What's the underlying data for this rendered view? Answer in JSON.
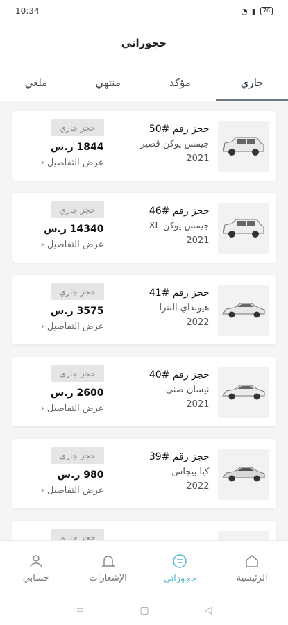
{
  "status_bar": {
    "time": "10:34",
    "battery": "76"
  },
  "header": {
    "title": "حجوزاتي"
  },
  "tabs": [
    {
      "label": "جاري"
    },
    {
      "label": "مؤكد"
    },
    {
      "label": "منتهي"
    },
    {
      "label": "ملغي"
    }
  ],
  "bookings": [
    {
      "booking_no": "حجز رقم #50",
      "car": "جيمس يوكن قصير",
      "year": "2021",
      "status": "حجز جاري",
      "price": "1844 ر.س",
      "details": "عرض التفاصيل"
    },
    {
      "booking_no": "حجز رقم #46",
      "car": "جيمس يوكن XL",
      "year": "2021",
      "status": "حجز جاري",
      "price": "14340 ر.س",
      "details": "عرض التفاصيل"
    },
    {
      "booking_no": "حجز رقم #41",
      "car": "هيونداي النترا",
      "year": "2022",
      "status": "حجز جاري",
      "price": "3575 ر.س",
      "details": "عرض التفاصيل"
    },
    {
      "booking_no": "حجز رقم #40",
      "car": "نيسان صني",
      "year": "2021",
      "status": "حجز جاري",
      "price": "2600 ر.س",
      "details": "عرض التفاصيل"
    },
    {
      "booking_no": "حجز رقم #39",
      "car": "كيا بيجاس",
      "year": "2022",
      "status": "حجز جاري",
      "price": "980 ر.س",
      "details": "عرض التفاصيل"
    }
  ],
  "bottom_nav": [
    {
      "label": "الرئيسية",
      "icon": "home-icon"
    },
    {
      "label": "حجوزاتي",
      "icon": "bookings-icon"
    },
    {
      "label": "الإشعارات",
      "icon": "bell-icon"
    },
    {
      "label": "حسابي",
      "icon": "user-icon"
    }
  ],
  "colors": {
    "accent": "#4fb6cf",
    "tab_indicator": "#6b7680"
  }
}
